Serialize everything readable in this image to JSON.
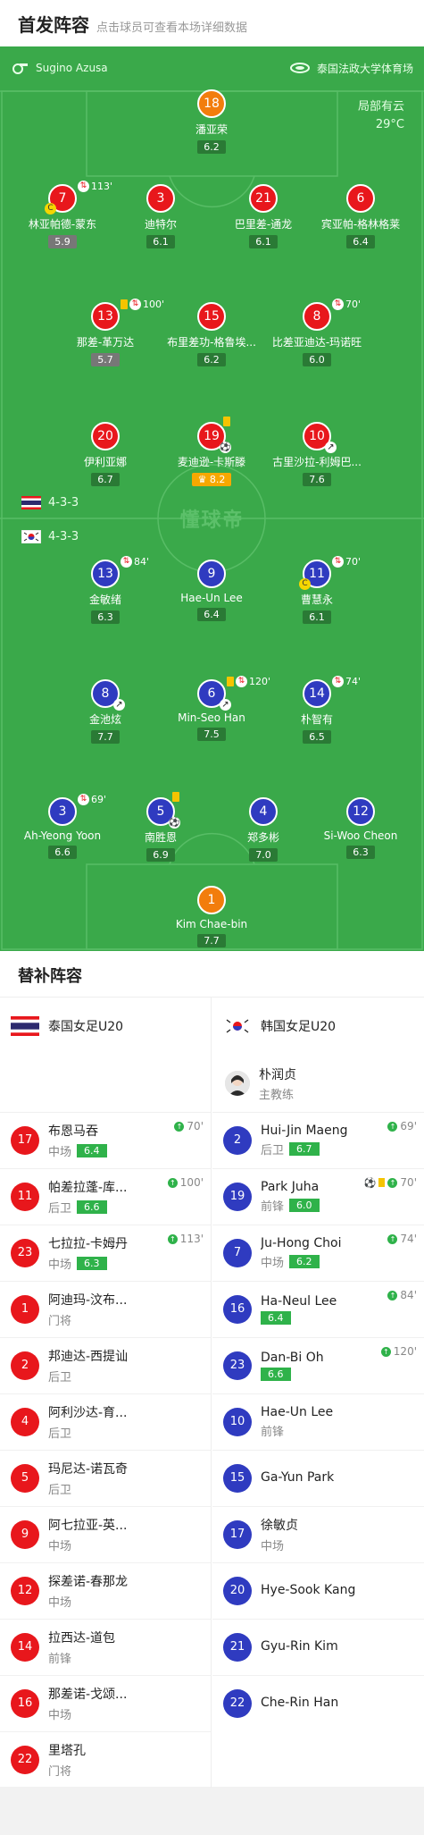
{
  "header": {
    "title": "首发阵容",
    "subtitle": "点击球员可查看本场详细数据"
  },
  "match": {
    "referee": "Sugino Azusa",
    "venue": "泰国法政大学体育场",
    "weather": "局部有云",
    "temperature": "29°C",
    "watermark": "懂球帝"
  },
  "home_formation": "4-3-3",
  "away_formation": "4-3-3",
  "home_players": [
    {
      "num": "18",
      "name": "潘亚荣",
      "rating": "6.2"
    },
    {
      "num": "7",
      "name": "林亚帕德-蒙东",
      "rating": "5.9",
      "sub": "113'"
    },
    {
      "num": "3",
      "name": "迪特尔",
      "rating": "6.1"
    },
    {
      "num": "21",
      "name": "巴里差-通龙",
      "rating": "6.1"
    },
    {
      "num": "6",
      "name": "宾亚帕-格林格莱",
      "rating": "6.4"
    },
    {
      "num": "13",
      "name": "那差-革万达",
      "rating": "5.7",
      "sub": "100'"
    },
    {
      "num": "15",
      "name": "布里差功-格鲁埃...",
      "rating": "6.2"
    },
    {
      "num": "8",
      "name": "比差亚迪达-玛诺旺",
      "rating": "6.0",
      "sub": "70'"
    },
    {
      "num": "20",
      "name": "伊利亚娜",
      "rating": "6.7"
    },
    {
      "num": "19",
      "name": "麦迪逊-卡斯滕",
      "rating": "8.2"
    },
    {
      "num": "10",
      "name": "古里沙拉-利姆巴...",
      "rating": "7.6"
    }
  ],
  "away_players": [
    {
      "num": "13",
      "name": "金敏绪",
      "rating": "6.3",
      "sub": "84'"
    },
    {
      "num": "9",
      "name": "Hae-Un Lee",
      "rating": "6.4"
    },
    {
      "num": "11",
      "name": "曹慧永",
      "rating": "6.1",
      "sub": "70'"
    },
    {
      "num": "8",
      "name": "金池炫",
      "rating": "7.7"
    },
    {
      "num": "6",
      "name": "Min-Seo Han",
      "rating": "7.5",
      "sub": "120'"
    },
    {
      "num": "14",
      "name": "朴智有",
      "rating": "6.5",
      "sub": "74'"
    },
    {
      "num": "3",
      "name": "Ah-Yeong Yoon",
      "rating": "6.6",
      "sub": "69'"
    },
    {
      "num": "5",
      "name": "南胜恩",
      "rating": "6.9"
    },
    {
      "num": "4",
      "name": "郑多彬",
      "rating": "7.0"
    },
    {
      "num": "12",
      "name": "Si-Woo Cheon",
      "rating": "6.3"
    },
    {
      "num": "1",
      "name": "Kim Chae-bin",
      "rating": "7.7"
    }
  ],
  "bench": {
    "title": "替补阵容",
    "home_team": "泰国女足U20",
    "away_team": "韩国女足U20",
    "coach_name": "朴润贞",
    "coach_role": "主教练",
    "home": [
      {
        "num": "17",
        "name": "布恩马吞",
        "pos": "中场",
        "rating": "6.4",
        "event": "70'"
      },
      {
        "num": "11",
        "name": "帕差拉蓬-库...",
        "pos": "后卫",
        "rating": "6.6",
        "event": "100'"
      },
      {
        "num": "23",
        "name": "七拉拉-卡姆丹",
        "pos": "中场",
        "rating": "6.3",
        "event": "113'"
      },
      {
        "num": "1",
        "name": "阿迪玛-汶布...",
        "pos": "门将"
      },
      {
        "num": "2",
        "name": "邦迪达-西提讪",
        "pos": "后卫"
      },
      {
        "num": "4",
        "name": "阿利沙达-育...",
        "pos": "后卫"
      },
      {
        "num": "5",
        "name": "玛尼达-诺瓦奇",
        "pos": "后卫"
      },
      {
        "num": "9",
        "name": "阿七拉亚-英...",
        "pos": "中场"
      },
      {
        "num": "12",
        "name": "探差诺-春那龙",
        "pos": "中场"
      },
      {
        "num": "14",
        "name": "拉西达-道包",
        "pos": "前锋"
      },
      {
        "num": "16",
        "name": "那差诺-戈颂...",
        "pos": "中场"
      },
      {
        "num": "22",
        "name": "里塔孔",
        "pos": "门将"
      }
    ],
    "away": [
      {
        "num": "2",
        "name": "Hui-Jin Maeng",
        "pos": "后卫",
        "rating": "6.7",
        "event": "69'"
      },
      {
        "num": "19",
        "name": "Park Juha",
        "pos": "前锋",
        "rating": "6.0",
        "event": "70'"
      },
      {
        "num": "7",
        "name": "Ju-Hong Choi",
        "pos": "中场",
        "rating": "6.2",
        "event": "74'"
      },
      {
        "num": "16",
        "name": "Ha-Neul Lee",
        "pos": "",
        "rating": "6.4",
        "event": "84'"
      },
      {
        "num": "23",
        "name": "Dan-Bi Oh",
        "pos": "",
        "rating": "6.6",
        "event": "120'"
      },
      {
        "num": "10",
        "name": "Hae-Un Lee",
        "pos": "前锋"
      },
      {
        "num": "15",
        "name": "Ga-Yun Park",
        "pos": ""
      },
      {
        "num": "17",
        "name": "徐敏贞",
        "pos": "中场"
      },
      {
        "num": "20",
        "name": "Hye-Sook Kang",
        "pos": ""
      },
      {
        "num": "21",
        "name": "Gyu-Rin Kim",
        "pos": ""
      },
      {
        "num": "22",
        "name": "Che-Rin Han",
        "pos": ""
      }
    ]
  }
}
